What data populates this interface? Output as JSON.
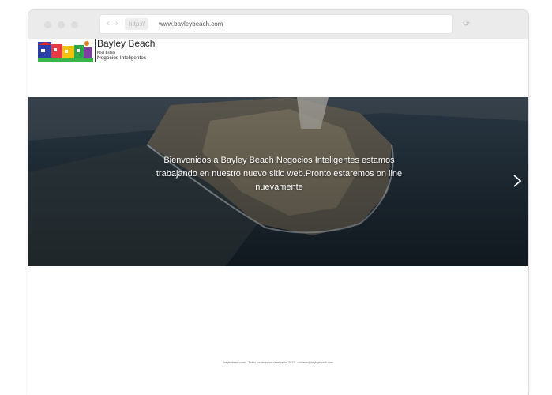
{
  "browser": {
    "protocol": "http://",
    "url": "www.bayleybeach.com",
    "back_icon": "chevron-left-icon",
    "forward_icon": "chevron-right-icon",
    "reload_icon": "reload-icon"
  },
  "brand": {
    "name": "Bayley Beach",
    "subtitle1": "Real Estate",
    "subtitle2": "Negocios Inteligentes",
    "logo_icon": "colorful-houses-logo"
  },
  "hero": {
    "message": "Bienvenidos a Bayley Beach Negocios Inteligentes estamos trabajando en nuestro nuevo sitio web.Pronto estaremos on line nuevamente",
    "next_icon": "chevron-right-icon"
  },
  "footer": {
    "text": "bayleybeach.com - Todos los derechos reservados 2017 - contacto@bayleybeach.com"
  }
}
